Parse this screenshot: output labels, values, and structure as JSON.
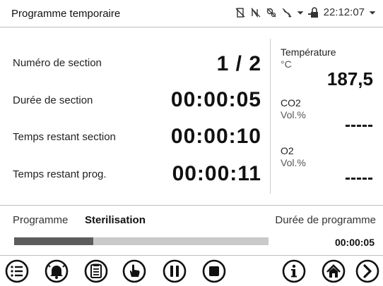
{
  "header": {
    "title": "Programme temporaire",
    "clock": "22:12:07",
    "status_icons": [
      "no-door-icon",
      "no-network-icon",
      "no-sensor-icon",
      "no-usb-icon",
      "dropdown-icon",
      "lock-icon",
      "dropdown-icon"
    ]
  },
  "section": {
    "number_label": "Numéro de section",
    "number_value": "1 / 2",
    "duration_label": "Durée de section",
    "duration_value": "00:00:05",
    "remaining_section_label": "Temps restant section",
    "remaining_section_value": "00:00:10",
    "remaining_prog_label": "Temps restant prog.",
    "remaining_prog_value": "00:00:11"
  },
  "readings": {
    "temperature_label": "Température",
    "temperature_unit": "°C",
    "temperature_value": "187,5",
    "co2_label": "CO2",
    "co2_unit": "Vol.%",
    "co2_value": "-----",
    "o2_label": "O2",
    "o2_unit": "Vol.%",
    "o2_value": "-----"
  },
  "program": {
    "label": "Programme",
    "name": "Sterilisation",
    "duration_label": "Durée de programme",
    "duration_value": "00:00:05",
    "progress_fraction": 0.31
  },
  "toolbar": {
    "buttons": [
      "menu-icon",
      "alarm-icon",
      "clipboard-icon",
      "hand-touch-icon",
      "pause-icon",
      "stop-icon",
      "info-icon",
      "home-icon",
      "next-icon"
    ]
  },
  "colors": {
    "progress_fill": "#5c5c5c",
    "progress_track": "#c9c9c9",
    "divider": "#bdbdbd"
  }
}
